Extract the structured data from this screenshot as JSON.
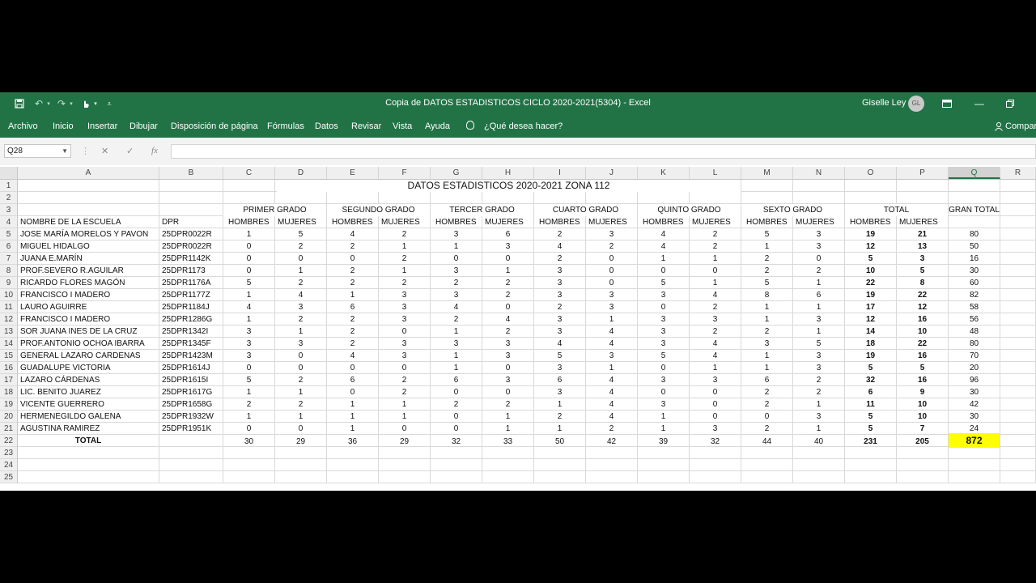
{
  "window": {
    "title": "Copia de DATOS ESTADISTICOS CICLO 2020-2021(5304)  -  Excel",
    "user": "Giselle Ley",
    "avatar_initials": "GL",
    "accent_color": "#217346"
  },
  "ribbon": {
    "tabs": [
      "Archivo",
      "Inicio",
      "Insertar",
      "Dibujar",
      "Disposición de página",
      "Fórmulas",
      "Datos",
      "Revisar",
      "Vista",
      "Ayuda"
    ],
    "tell_me": "¿Qué desea hacer?",
    "share": "Compartir"
  },
  "formula_bar": {
    "name_box": "Q28",
    "fx_label": "fx",
    "content": ""
  },
  "sheet": {
    "columns": [
      "A",
      "B",
      "C",
      "D",
      "E",
      "F",
      "G",
      "H",
      "I",
      "J",
      "K",
      "L",
      "M",
      "N",
      "O",
      "P",
      "Q",
      "R"
    ],
    "selected_column": "Q",
    "rows": [
      "1",
      "2",
      "3",
      "4",
      "5",
      "6",
      "7",
      "8",
      "9",
      "10",
      "11",
      "12",
      "13",
      "14",
      "15",
      "16",
      "17",
      "18",
      "19",
      "20",
      "21",
      "22",
      "23",
      "24",
      "25"
    ],
    "title": "DATOS ESTADISTICOS 2020-2021 ZONA 112",
    "grade_headers": [
      "PRIMER GRADO",
      "SEGUNDO GRADO",
      "TERCER GRADO",
      "CUARTO GRADO",
      "QUINTO GRADO",
      "SEXTO GRADO",
      "TOTAL"
    ],
    "gran_total_header": "GRAN TOTAL",
    "school_header": "NOMBRE DE LA ESCUELA",
    "dpr_header": "DPR",
    "hombres": "HOMBRES",
    "mujeres": "MUJERES",
    "schools": [
      {
        "name": "JOSE MARÍA MORELOS Y PAVON",
        "dpr": "25DPR0022R",
        "v": [
          1,
          5,
          4,
          2,
          3,
          6,
          2,
          3,
          4,
          2,
          5,
          3,
          19,
          21,
          80
        ]
      },
      {
        "name": "MIGUEL HIDALGO",
        "dpr": "25DPR0022R",
        "v": [
          0,
          2,
          2,
          1,
          1,
          3,
          4,
          2,
          4,
          2,
          1,
          3,
          12,
          13,
          50
        ]
      },
      {
        "name": "JUANA E.MARÍN",
        "dpr": "25DPR1142K",
        "v": [
          0,
          0,
          0,
          2,
          0,
          0,
          2,
          0,
          1,
          1,
          2,
          0,
          5,
          3,
          16
        ]
      },
      {
        "name": "PROF.SEVERO R.AGUILAR",
        "dpr": "25DPR1173",
        "v": [
          0,
          1,
          2,
          1,
          3,
          1,
          3,
          0,
          0,
          0,
          2,
          2,
          10,
          5,
          30
        ]
      },
      {
        "name": "RICARDO FLORES MAGÓN",
        "dpr": "25DPR1176A",
        "v": [
          5,
          2,
          2,
          2,
          2,
          2,
          3,
          0,
          5,
          1,
          5,
          1,
          22,
          8,
          60
        ]
      },
      {
        "name": "FRANCISCO I MADERO",
        "dpr": "25DPR1177Z",
        "v": [
          1,
          4,
          1,
          3,
          3,
          2,
          3,
          3,
          3,
          4,
          8,
          6,
          19,
          22,
          82
        ]
      },
      {
        "name": "LAURO AGUIRRE",
        "dpr": "25DPR1184J",
        "v": [
          4,
          3,
          6,
          3,
          4,
          0,
          2,
          3,
          0,
          2,
          1,
          1,
          17,
          12,
          58
        ]
      },
      {
        "name": "FRANCISCO I MADERO",
        "dpr": "25DPR1286G",
        "v": [
          1,
          2,
          2,
          3,
          2,
          4,
          3,
          1,
          3,
          3,
          1,
          3,
          12,
          16,
          56
        ]
      },
      {
        "name": "SOR JUANA INES DE LA CRUZ",
        "dpr": "25DPR1342I",
        "v": [
          3,
          1,
          2,
          0,
          1,
          2,
          3,
          4,
          3,
          2,
          2,
          1,
          14,
          10,
          48
        ]
      },
      {
        "name": "PROF.ANTONIO OCHOA IBARRA",
        "dpr": "25DPR1345F",
        "v": [
          3,
          3,
          2,
          3,
          3,
          3,
          4,
          4,
          3,
          4,
          3,
          5,
          18,
          22,
          80
        ]
      },
      {
        "name": "GENERAL LAZARO CARDENAS",
        "dpr": "25DPR1423M",
        "v": [
          3,
          0,
          4,
          3,
          1,
          3,
          5,
          3,
          5,
          4,
          1,
          3,
          19,
          16,
          70
        ]
      },
      {
        "name": "GUADALUPE VICTORIA",
        "dpr": "25DPR1614J",
        "v": [
          0,
          0,
          0,
          0,
          1,
          0,
          3,
          1,
          0,
          1,
          1,
          3,
          5,
          5,
          20
        ]
      },
      {
        "name": "LAZARO CÁRDENAS",
        "dpr": "25DPR1615I",
        "v": [
          5,
          2,
          6,
          2,
          6,
          3,
          6,
          4,
          3,
          3,
          6,
          2,
          32,
          16,
          96
        ]
      },
      {
        "name": "LIC. BENITO JUAREZ",
        "dpr": "25DPR1617G",
        "v": [
          1,
          1,
          0,
          2,
          0,
          0,
          3,
          4,
          0,
          0,
          2,
          2,
          6,
          9,
          30
        ]
      },
      {
        "name": "VICENTE GUERRERO",
        "dpr": "25DPR1658G",
        "v": [
          2,
          2,
          1,
          1,
          2,
          2,
          1,
          4,
          3,
          0,
          2,
          1,
          11,
          10,
          42
        ]
      },
      {
        "name": "HERMENEGILDO GALENA",
        "dpr": "25DPR1932W",
        "v": [
          1,
          1,
          1,
          1,
          0,
          1,
          2,
          4,
          1,
          0,
          0,
          3,
          5,
          10,
          30
        ]
      },
      {
        "name": "AGUSTINA RAMIREZ",
        "dpr": "25DPR1951K",
        "v": [
          0,
          0,
          1,
          0,
          0,
          1,
          1,
          2,
          1,
          3,
          2,
          1,
          5,
          7,
          24
        ]
      }
    ],
    "total_label": "TOTAL",
    "totals": [
      30,
      29,
      36,
      29,
      32,
      33,
      50,
      42,
      39,
      32,
      44,
      40,
      231,
      205,
      872
    ],
    "highlight_color": "#ffff00"
  }
}
